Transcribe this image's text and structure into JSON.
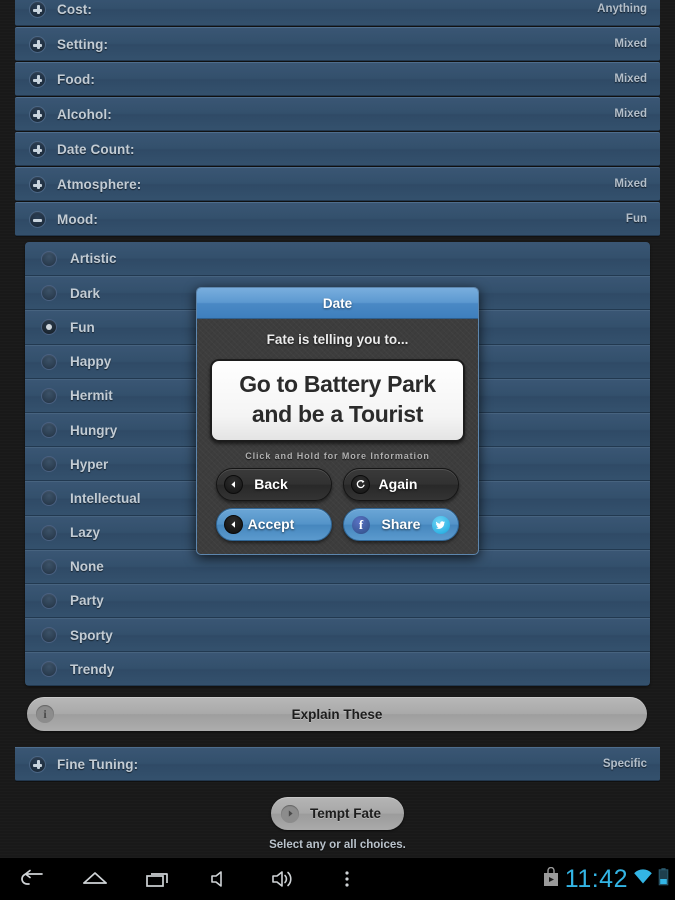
{
  "app": {
    "categories": [
      {
        "label": "Cost:",
        "value": "Anything",
        "state": "collapsed"
      },
      {
        "label": "Setting:",
        "value": "Mixed",
        "state": "collapsed"
      },
      {
        "label": "Food:",
        "value": "Mixed",
        "state": "collapsed"
      },
      {
        "label": "Alcohol:",
        "value": "Mixed",
        "state": "collapsed"
      },
      {
        "label": "Date Count:",
        "value": "",
        "state": "collapsed"
      },
      {
        "label": "Atmosphere:",
        "value": "Mixed",
        "state": "collapsed"
      },
      {
        "label": "Mood:",
        "value": "Fun",
        "state": "expanded"
      }
    ],
    "mood_options": [
      {
        "label": "Artistic",
        "selected": false
      },
      {
        "label": "Dark",
        "selected": false
      },
      {
        "label": "Fun",
        "selected": true
      },
      {
        "label": "Happy",
        "selected": false
      },
      {
        "label": "Hermit",
        "selected": false
      },
      {
        "label": "Hungry",
        "selected": false
      },
      {
        "label": "Hyper",
        "selected": false
      },
      {
        "label": "Intellectual",
        "selected": false
      },
      {
        "label": "Lazy",
        "selected": false
      },
      {
        "label": "None",
        "selected": false
      },
      {
        "label": "Party",
        "selected": false
      },
      {
        "label": "Sporty",
        "selected": false
      },
      {
        "label": "Trendy",
        "selected": false
      }
    ],
    "explain_button": "Explain These",
    "fine_tuning": {
      "label": "Fine Tuning:",
      "value": "Specific"
    },
    "tempt_fate_button": "Tempt Fate",
    "hint": "Select any or all choices."
  },
  "dialog": {
    "title": "Date",
    "subtitle": "Fate is telling you to...",
    "result_line1": "Go to Battery Park",
    "result_line2": "and be a Tourist",
    "hold_hint": "Click and Hold for More Information",
    "back_button": "Back",
    "again_button": "Again",
    "accept_button": "Accept",
    "share_button": "Share"
  },
  "statusbar": {
    "time": "11:42"
  },
  "colors": {
    "row_blue": "#33506c",
    "accent_blue": "#5393c8",
    "dialog_dark": "#3d3d3d",
    "status_cyan": "#33b5e5",
    "gray_button": "#a9a9a9"
  }
}
